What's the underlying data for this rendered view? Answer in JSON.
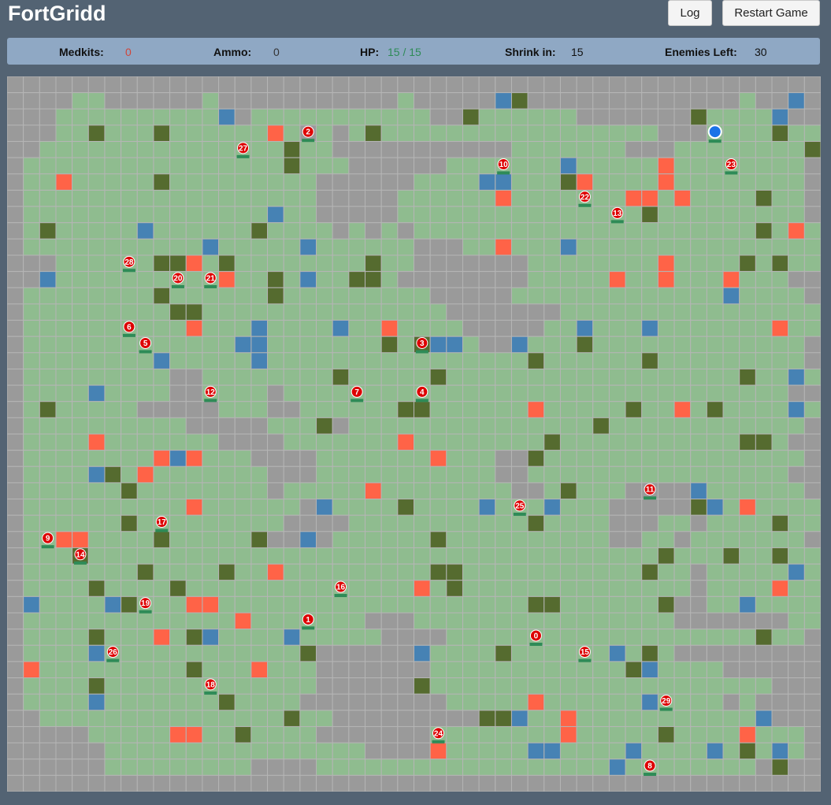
{
  "app": {
    "title": "FortGridd"
  },
  "buttons": {
    "log": "Log",
    "restart": "Restart Game"
  },
  "stats": {
    "medkits_label": "Medkits:",
    "medkits_value": "0",
    "ammo_label": "Ammo:",
    "ammo_value": "0",
    "hp_label": "HP:",
    "hp_value": "15 / 15",
    "shrink_label": "Shrink in:",
    "shrink_value": "15",
    "enemies_label": "Enemies Left:",
    "enemies_value": "30"
  },
  "colors": {
    "background": "#536373",
    "storm": "#9a9a9a",
    "grass": "#8fbc8f",
    "wall": "#556b2f",
    "medkit": "#ff6347",
    "ammo": "#4682b4",
    "enemy": "#dd0000",
    "player": "#1a73e8",
    "health_bar": "#2e8b57",
    "medkits_value": "#d0453a",
    "ammo_value": "#333333",
    "hp_value": "#2e8b57"
  },
  "map": {
    "cols": 50,
    "rows": 44,
    "legend": ".=storm G=grass W=wall M=medkit A=ammo",
    "tiles": [
      "..................................................",
      "....GG......G...........G.....AW.............G..A.",
      "...GGGGGGGGGGA.GGGGGGGGGGG..WGGGGGG.......WGGGGA.",
      "...GGWGGGWGGGGGGMG.G.GWGGGGGGGGGGGGGGGGG...GGGGWGG.",
      "..GGGGGGGGGGGGGGGWGG...........GGGGGGG...GGGGGGGGW.",
      ".GGGGGGGGGGGGGGGGWGGG......GGGGGGGAGGGGGMGGGGGGGG.",
      ".GGMGGGGGWGGGGGGGGG......GGGGAAGGGWMGGGGMGGGGGGGG.",
      ".GGGGGGGGGGGGGGGGGG.....GGGGGGMGGGGGGGMMGMGGGGWGG..",
      ".GGGGGGGGGGGGGGGAGG.....GGGGGGGGGGGGGGGWGGGGGGGGG..",
      ".GWGGGGGAGGGGGGWGGGG.G.G.GGGGGGGGGGGGGGGGGGGGGWGMG.",
      ".GGGGGGGGGGGAGGGGGAGGGGGG...GGMGGGAGGGGGGGGGGGGGGG.",
      "...GGGGGGWWMGWGGGGGGGGWGG.......GGGGGGGGMGGGGWGWGG.",
      "..AGGGGGGGGGGMGGWGAGGWWG........GGGGGMGGMGGGMGGG..",
      ".GGGGGGGGWGGGGGGWGGGGGGGGG.....GGGGGGGGGGGGGAGGGG.",
      ".GGGGGGGGGWWGGGGGGGGGGGGGGG.......GGGGGGGGGGGGGGGG..",
      ".GGGGGGGGGGMGGGAGGGGAGGMGGGG.....GGAGGGAGGGGGGGMGG..",
      ".GGGGGGGGGGGGGAAGGGGGGGWGWAAG..AGGGWGGGGGGGGGGGGG..",
      ".GGGGGGGGAGGGGGAGGGGGGGGGGGGGGGGWGGGGGGWGGGGGGGGG..",
      ".GGGGGGGGG..GGGGGGGGWGGGGGWGGGGGGGGGGGGGGGGGGWGGAG.",
      ".GGGGAGGGG..GGGG.GGGGGGGGGGGGGGGGGGGGGGGGGGGGGGG..",
      ".GWGGGGG.....GGG..GGGGGGWWGGGGGGMGGGGGWGGMGWGGGGAG.",
      ".GGGGGGGGGG.....GGGW.GGGGGGGGGGGGGGGWGGGGGGGGGGGG.",
      ".GGGGMGGGGGGG....GGGGGGGMGGGGGGGGWGGGGGGGGGGGWWG..",
      ".GGGGGGGGMAMGGG....GGGGGGGMGGG..WGGGGGGGGGGGGGGGG.",
      ".GGGGAWGMGGGGGGG...GGGGGGGGGGG..GGGGGGGGGGGGGGGG..",
      ".GGGGGGWGGGGGGGG.GGGGGMGGGGGGGG..GWGGG....AGGGGGG.",
      ".GGGGGGGGGGMGGGGGG.AGGGGWGGGGAGGGAGGG.....WAGMGGGG.",
      ".GGGGGGWGGGGGGGGG....GGGGGGGGGGGWGGGG...GG.GGGGWGG.",
      ".GGMMGGGGWGGGGGW..A.GGGGGGWGGGGGGGGGG..GG.GGGGGGG..",
      ".GGGWGGGGGGGGGGGGGGGGGGGGGGGGGGGGGGGGGGGWGGGWGGWGG.",
      ".GGGGGGGWGGGGWGGMGGGGGGGGGWWGGGGGGGGGGGWGG.GGGGGAG.",
      ".GGGGWGGGGWGGGGGGGGGGGGGGMGWGGGGGGGGGGGGGG.GGGGMGG..",
      ".AGGGGAWGGGMMGGGGGGGGGGGGGGGGGGGWWGGGGGGW..GGAGGGG.",
      ".GGGGGGGGGGGGGMGGGGGGG...GGGGGGGGGGGGGGGG.......GG.",
      ".GGGGWGGGMGWAGGGGAGGGGG....GGGGGGGGGGGGGGGGGGGWGG..",
      ".GGGGAGGGGGGGGGGGGW......AGGGGWGGGGGGAGWG........",
      ".MGGGGGGGGGWGGGMGGG.......GGGGGGGGGGGGWAGGGG......",
      ".GGGGWGGGGGGGGGGGGG......WGGGGGGGGGGGGGGGGGGGGG...",
      ".GGGGAGGGGGGGWGGGG.........GGGGGMGGGGGGAGGGG.G....",
      "..GGGGGGGGGGGGGGGWGG.........WWAGGMGGGGGGGGGGGA....",
      ".....GGGGGMMGGWGGGG.......GGGGGGGGMGGGGGWGGGGMGGG..",
      "......GGGGGGGGGGGGGGGG....MGGGGGAAGGGGAGGGGAGWGAG..",
      "......GGGGGGGGG....GGGGGGGGGGGGGGGGGGAGGGGGGGG.W...",
      ".................................................."
    ]
  },
  "player": {
    "col": 43,
    "row": 3
  },
  "enemies": [
    {
      "id": "0",
      "col": 32,
      "row": 34
    },
    {
      "id": "1",
      "col": 18,
      "row": 33
    },
    {
      "id": "2",
      "col": 18,
      "row": 3
    },
    {
      "id": "3",
      "col": 25,
      "row": 16
    },
    {
      "id": "4",
      "col": 25,
      "row": 19
    },
    {
      "id": "5",
      "col": 8,
      "row": 16
    },
    {
      "id": "6",
      "col": 7,
      "row": 15
    },
    {
      "id": "7",
      "col": 21,
      "row": 19
    },
    {
      "id": "8",
      "col": 39,
      "row": 42
    },
    {
      "id": "9",
      "col": 2,
      "row": 28
    },
    {
      "id": "10",
      "col": 30,
      "row": 5
    },
    {
      "id": "11",
      "col": 39,
      "row": 25
    },
    {
      "id": "12",
      "col": 12,
      "row": 19
    },
    {
      "id": "13",
      "col": 37,
      "row": 8
    },
    {
      "id": "14",
      "col": 4,
      "row": 29
    },
    {
      "id": "15",
      "col": 35,
      "row": 35
    },
    {
      "id": "16",
      "col": 20,
      "row": 31
    },
    {
      "id": "17",
      "col": 9,
      "row": 27
    },
    {
      "id": "18",
      "col": 12,
      "row": 37
    },
    {
      "id": "19",
      "col": 8,
      "row": 32
    },
    {
      "id": "20",
      "col": 10,
      "row": 12
    },
    {
      "id": "21",
      "col": 12,
      "row": 12
    },
    {
      "id": "22",
      "col": 35,
      "row": 7
    },
    {
      "id": "23",
      "col": 44,
      "row": 5
    },
    {
      "id": "24",
      "col": 26,
      "row": 40
    },
    {
      "id": "25",
      "col": 31,
      "row": 26
    },
    {
      "id": "26",
      "col": 6,
      "row": 35
    },
    {
      "id": "27",
      "col": 14,
      "row": 4
    },
    {
      "id": "28",
      "col": 7,
      "row": 11
    },
    {
      "id": "29",
      "col": 40,
      "row": 38
    }
  ]
}
